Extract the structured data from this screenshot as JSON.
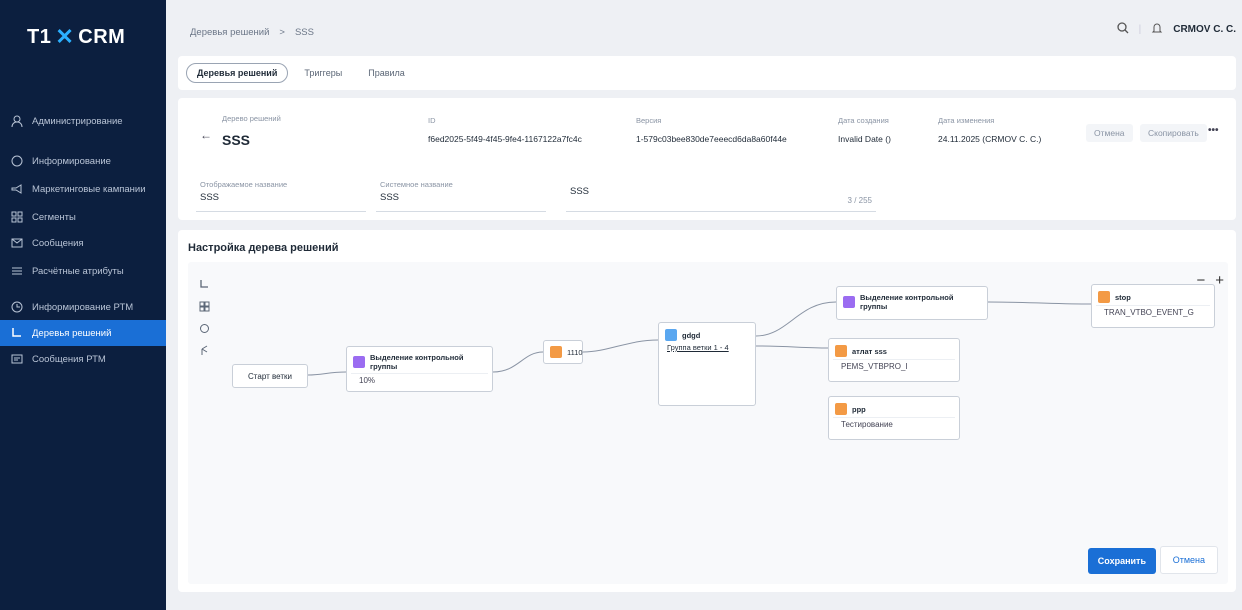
{
  "app": {
    "logo_text": "T1",
    "logo_suffix": "CRM"
  },
  "sidebar": {
    "items": [
      {
        "label": "Администрирование",
        "icon": "admin-icon"
      },
      {
        "label": "Информирование",
        "icon": "info-icon"
      },
      {
        "label": "Маркетинговые кампании",
        "icon": "campaign-icon"
      },
      {
        "label": "Сегменты",
        "icon": "segments-icon"
      },
      {
        "label": "Сообщения",
        "icon": "messages-icon"
      },
      {
        "label": "Расчётные атрибуты",
        "icon": "attributes-icon"
      },
      {
        "label": "Информирование РТМ",
        "icon": "rtm-icon"
      },
      {
        "label": "Деревья решений",
        "icon": "tree-icon"
      },
      {
        "label": "Сообщения РТМ",
        "icon": "rtm-messages-icon"
      }
    ]
  },
  "breadcrumb": {
    "parent": "Деревья решений",
    "separator": ">",
    "current": "SSS"
  },
  "header": {
    "user": "CRMOV C. C."
  },
  "tabs": [
    "Деревья решений",
    "Триггеры",
    "Правила"
  ],
  "info": {
    "name_label": "Дерево решений",
    "name_value": "SSS",
    "id_label": "ID",
    "id_value": "f6ed2025-5f49-4f45-9fe4-1167122a7fc4c",
    "version_label": "Версия",
    "version_value": "1-579c03bee830de7eeecd6da8a60f44e",
    "created_label": "Дата создания",
    "created_value": "Invalid Date ()",
    "changed_label": "Дата изменения",
    "changed_value": "24.11.2025 (CRMOV C. C.)",
    "btn_cancel": "Отмена",
    "btn_copy": "Скопировать",
    "more": "•••"
  },
  "inputs": [
    {
      "label": "Отображаемое название",
      "value": "SSS"
    },
    {
      "label": "Системное название",
      "value": "SSS"
    },
    {
      "label": "",
      "value": "SSS",
      "counter": "3 / 255"
    }
  ],
  "tree": {
    "title": "Настройка дерева решений",
    "zoom_out": "−",
    "zoom_in": "+",
    "start": "Старт ветки",
    "nodes": {
      "split1": {
        "title": "Выделение контрольной группы",
        "body": "10%"
      },
      "n1": {
        "title": "1110"
      },
      "group": {
        "title": "gdgd",
        "body": "Группа ветки 1 - 4"
      },
      "control2": {
        "title": "Выделение контрольной группы",
        "body": ""
      },
      "stop": {
        "title": "stop",
        "body": "TRAN_VTBO_EVENT_G"
      },
      "action": {
        "title": "атлат sss",
        "body": "PEMS_VTBPRO_I"
      },
      "test": {
        "title": "ррр",
        "body": "Тестирование"
      }
    }
  },
  "actions": {
    "save": "Сохранить",
    "cancel": "Отмена"
  }
}
